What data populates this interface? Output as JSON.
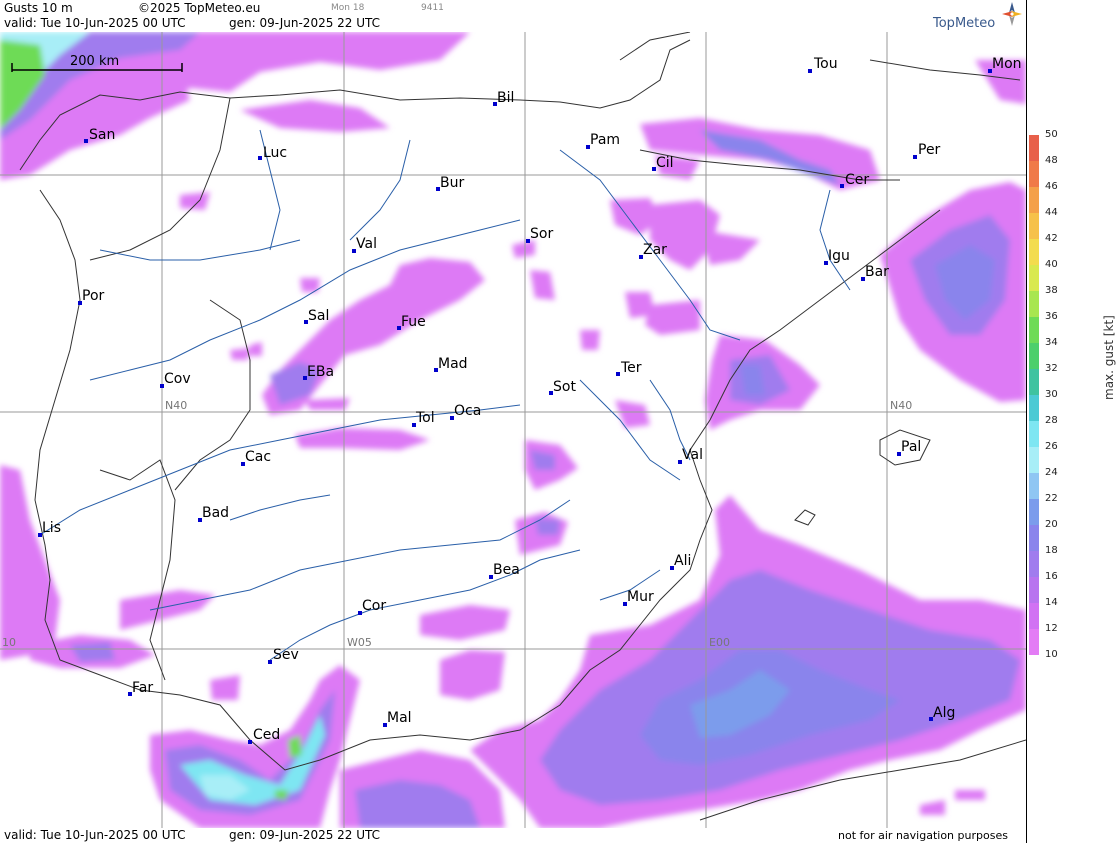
{
  "header": {
    "title": "Gusts 10 m",
    "copyright": "©2025 TopMeteo.eu",
    "day_code": "Mon 18",
    "run_id": "9411",
    "valid": "valid:  Tue  10-Jun-2025  00 UTC",
    "gen": "gen:  09-Jun-2025 22 UTC",
    "logo_text": "TopMeteo"
  },
  "footer": {
    "valid": "valid:  Tue  10-Jun-2025  00 UTC",
    "gen": "gen:  09-Jun-2025 22 UTC",
    "disclaimer": "not for air navigation purposes"
  },
  "map": {
    "scale_label": "200 km",
    "grid_labels": [
      {
        "id": "n40-west",
        "text": "N40"
      },
      {
        "id": "n40-east",
        "text": "N40"
      },
      {
        "id": "w05",
        "text": "W05"
      },
      {
        "id": "e00",
        "text": "E00"
      },
      {
        "id": "w10",
        "text": "10"
      }
    ],
    "cities": [
      {
        "id": "san",
        "name": "San"
      },
      {
        "id": "luc",
        "name": "Luc"
      },
      {
        "id": "bil",
        "name": "Bil"
      },
      {
        "id": "pam",
        "name": "Pam"
      },
      {
        "id": "tou",
        "name": "Tou"
      },
      {
        "id": "mon",
        "name": "Mon"
      },
      {
        "id": "per",
        "name": "Per"
      },
      {
        "id": "cil",
        "name": "Cil"
      },
      {
        "id": "cer",
        "name": "Cer"
      },
      {
        "id": "bur",
        "name": "Bur"
      },
      {
        "id": "sor",
        "name": "Sor"
      },
      {
        "id": "zar",
        "name": "Zar"
      },
      {
        "id": "igu",
        "name": "Igu"
      },
      {
        "id": "bar",
        "name": "Bar"
      },
      {
        "id": "val-n",
        "name": "Val"
      },
      {
        "id": "por",
        "name": "Por"
      },
      {
        "id": "sal",
        "name": "Sal"
      },
      {
        "id": "fue",
        "name": "Fue"
      },
      {
        "id": "mad",
        "name": "Mad"
      },
      {
        "id": "eba",
        "name": "EBa"
      },
      {
        "id": "ter",
        "name": "Ter"
      },
      {
        "id": "cov",
        "name": "Cov"
      },
      {
        "id": "sot",
        "name": "Sot"
      },
      {
        "id": "tol",
        "name": "Tol"
      },
      {
        "id": "oca",
        "name": "Oca"
      },
      {
        "id": "cac",
        "name": "Cac"
      },
      {
        "id": "val-e",
        "name": "Val"
      },
      {
        "id": "pal",
        "name": "Pal"
      },
      {
        "id": "bad",
        "name": "Bad"
      },
      {
        "id": "lis",
        "name": "Lis"
      },
      {
        "id": "ali",
        "name": "Ali"
      },
      {
        "id": "bea",
        "name": "Bea"
      },
      {
        "id": "mur",
        "name": "Mur"
      },
      {
        "id": "cor",
        "name": "Cor"
      },
      {
        "id": "sev",
        "name": "Sev"
      },
      {
        "id": "far",
        "name": "Far"
      },
      {
        "id": "mal",
        "name": "Mal"
      },
      {
        "id": "ced",
        "name": "Ced"
      },
      {
        "id": "alg",
        "name": "Alg"
      }
    ]
  },
  "legend": {
    "unit_label": "max. gust [kt]",
    "ticks": [
      "50",
      "48",
      "46",
      "44",
      "42",
      "40",
      "38",
      "36",
      "34",
      "32",
      "30",
      "28",
      "26",
      "24",
      "22",
      "20",
      "18",
      "16",
      "14",
      "12",
      "10"
    ],
    "colors": [
      "#e8604a",
      "#f07a48",
      "#f4a049",
      "#f6c14a",
      "#f3dc4e",
      "#d9e94f",
      "#a8e650",
      "#6edb57",
      "#4ccf6c",
      "#3fc3a0",
      "#4ccad4",
      "#7ee6f2",
      "#a8eef7",
      "#8fc6f3",
      "#7b9cec",
      "#8a84ec",
      "#a07cee",
      "#b874ef",
      "#d172f3",
      "#e37cf5"
    ]
  }
}
